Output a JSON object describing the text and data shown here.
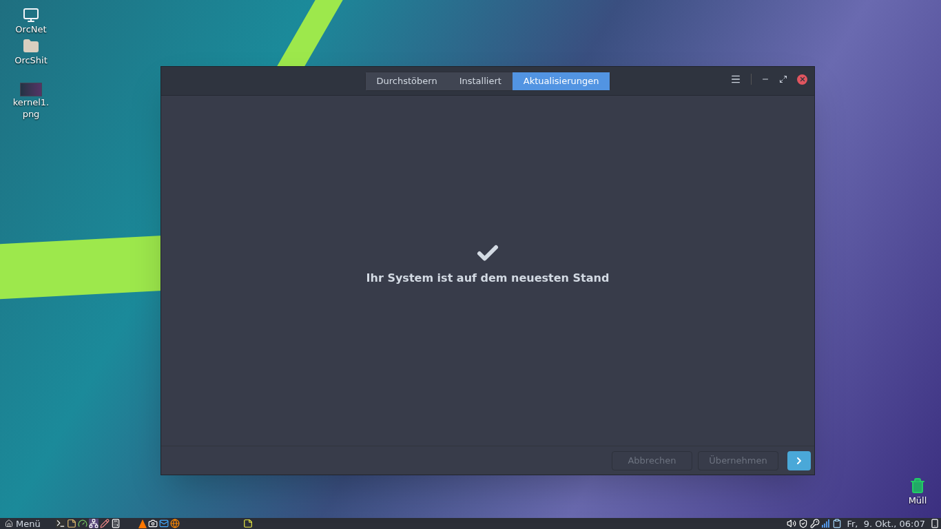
{
  "desktop_icons": [
    {
      "label": "OrcNet",
      "kind": "computer"
    },
    {
      "label": "OrcShit",
      "kind": "folder"
    },
    {
      "label": "kernel1.\npng",
      "kind": "image"
    }
  ],
  "trash": {
    "label": "Müll"
  },
  "window": {
    "tabs": [
      {
        "label": "Durchstöbern",
        "selected": false
      },
      {
        "label": "Installiert",
        "selected": false
      },
      {
        "label": "Aktualisierungen",
        "selected": true
      }
    ],
    "status_message": "Ihr System ist auf dem neuesten Stand",
    "buttons": [
      {
        "label": "Abbrechen",
        "disabled": true
      },
      {
        "label": "Übernehmen",
        "disabled": true
      }
    ]
  },
  "taskbar": {
    "menu_label": "Menü",
    "clock": "Fr,  9. Okt., 06:07"
  }
}
